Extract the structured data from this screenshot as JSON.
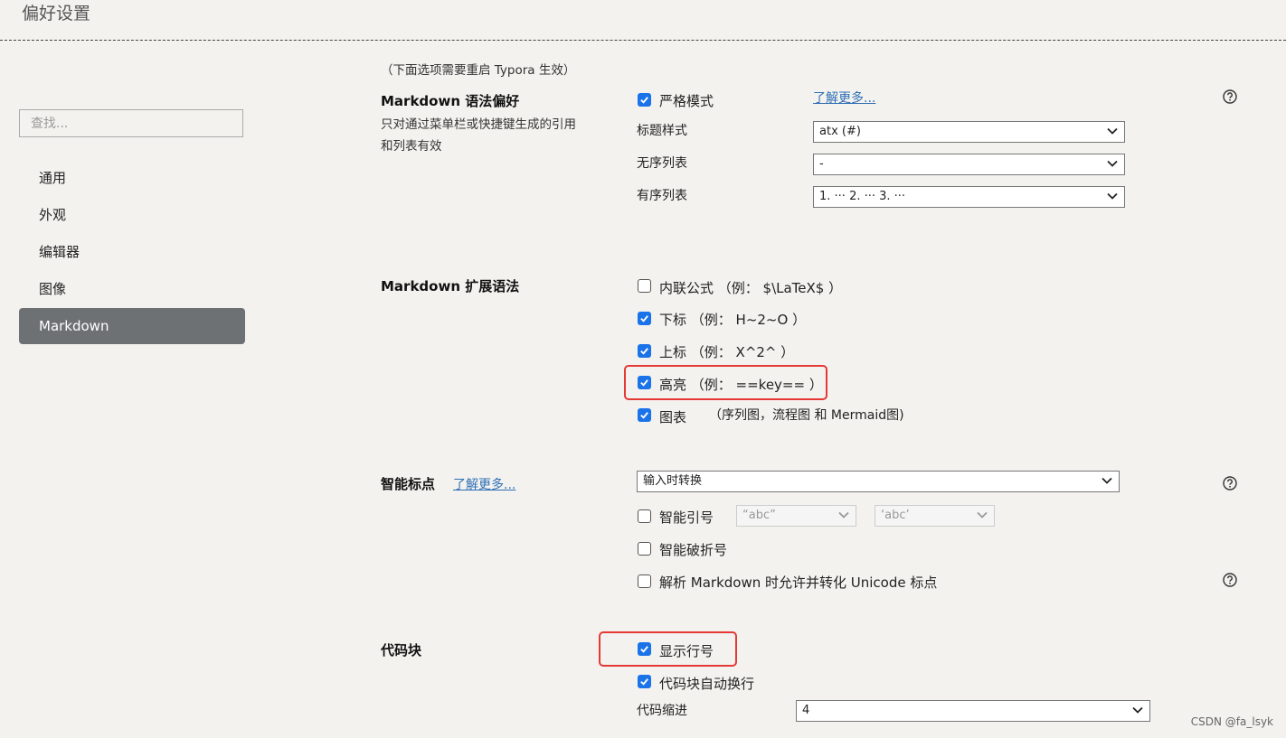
{
  "window": {
    "title": "偏好设置"
  },
  "sidebar": {
    "search_placeholder": "查找...",
    "items": [
      {
        "label": "通用"
      },
      {
        "label": "外观"
      },
      {
        "label": "编辑器"
      },
      {
        "label": "图像"
      },
      {
        "label": "Markdown",
        "active": true
      }
    ]
  },
  "restart_note": "（下面选项需要重启 Typora 生效）",
  "syntax_pref": {
    "title": "Markdown 语法偏好",
    "desc_line1": "只对通过菜单栏或快捷键生成的引用",
    "desc_line2": "和列表有效",
    "strict_mode": {
      "label": "严格模式",
      "checked": true
    },
    "learn_more": "了解更多...",
    "heading_style": {
      "label": "标题样式",
      "value": "atx (#)"
    },
    "unordered_list": {
      "label": "无序列表",
      "value": "-"
    },
    "ordered_list": {
      "label": "有序列表",
      "value": "1. ··· 2. ··· 3. ···"
    }
  },
  "ext_syntax": {
    "title": "Markdown 扩展语法",
    "inline_math": {
      "label": "内联公式 （例： $\\LaTeX$ ）",
      "checked": false
    },
    "subscript": {
      "label": "下标 （例： H~2~O ）",
      "checked": true
    },
    "superscript": {
      "label": "上标 （例： X^2^ ）",
      "checked": true
    },
    "highlight": {
      "label": "高亮 （例： ==key== ）",
      "checked": true
    },
    "diagrams": {
      "label": "图表",
      "sub": "（序列图，流程图 和 Mermaid图)",
      "checked": true
    }
  },
  "smart_punct": {
    "title": "智能标点",
    "learn_more": "了解更多...",
    "mode_value": "输入时转换",
    "smart_quotes": {
      "label": "智能引号",
      "checked": false,
      "double_value": "“abc”",
      "single_value": "‘abc’"
    },
    "smart_dash": {
      "label": "智能破折号",
      "checked": false
    },
    "unicode_punct": {
      "label": "解析 Markdown 时允许并转化 Unicode 标点",
      "checked": false
    }
  },
  "code_block": {
    "title": "代码块",
    "line_numbers": {
      "label": "显示行号",
      "checked": true
    },
    "wrap": {
      "label": "代码块自动换行",
      "checked": true
    },
    "indent": {
      "label": "代码缩进",
      "value": "4"
    }
  },
  "watermark": "CSDN @fa_lsyk",
  "colors": {
    "checkbox_blue": "#1a73e8",
    "annotation_red": "#e53935",
    "active_nav": "#6e7174",
    "link": "#2f6fb5"
  }
}
